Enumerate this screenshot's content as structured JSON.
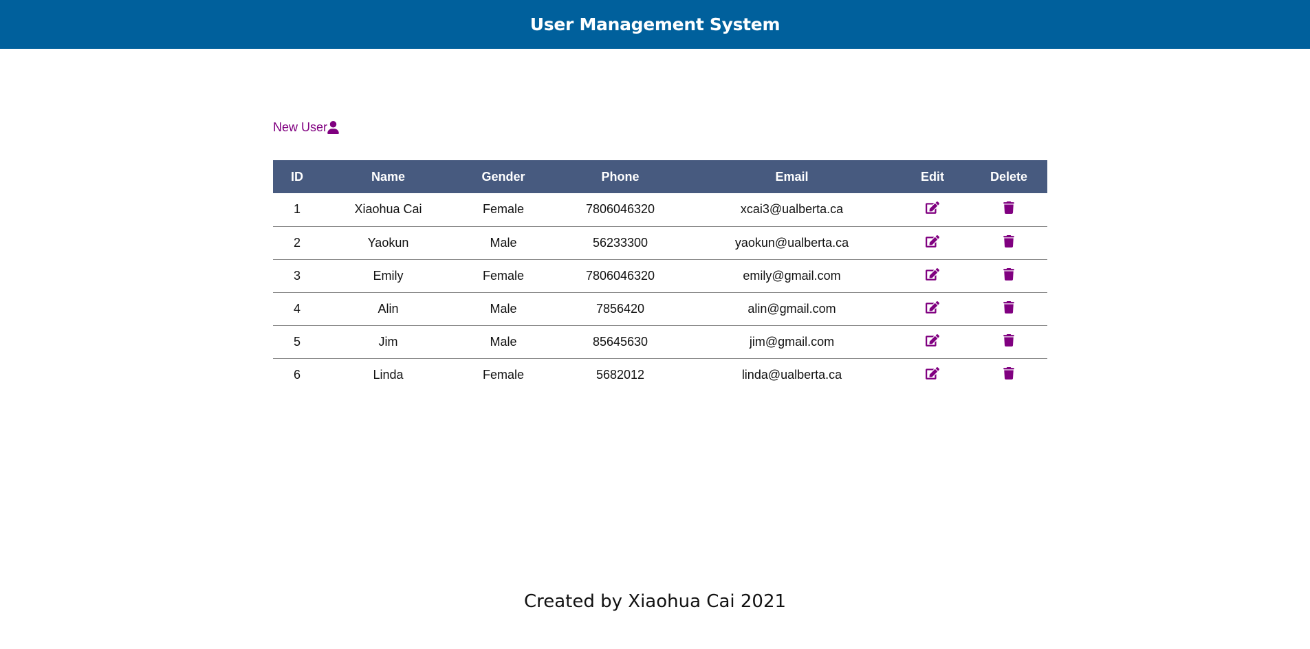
{
  "header": {
    "title": "User Management System"
  },
  "toolbar": {
    "new_user_label": "New User",
    "new_user_icon": "user-icon"
  },
  "table": {
    "columns": [
      "ID",
      "Name",
      "Gender",
      "Phone",
      "Email",
      "Edit",
      "Delete"
    ],
    "rows": [
      {
        "id": "1",
        "name": "Xiaohua Cai",
        "gender": "Female",
        "phone": "7806046320",
        "email": "xcai3@ualberta.ca"
      },
      {
        "id": "2",
        "name": "Yaokun",
        "gender": "Male",
        "phone": "56233300",
        "email": "yaokun@ualberta.ca"
      },
      {
        "id": "3",
        "name": "Emily",
        "gender": "Female",
        "phone": "7806046320",
        "email": "emily@gmail.com"
      },
      {
        "id": "4",
        "name": "Alin",
        "gender": "Male",
        "phone": "7856420",
        "email": "alin@gmail.com"
      },
      {
        "id": "5",
        "name": "Jim",
        "gender": "Male",
        "phone": "85645630",
        "email": "jim@gmail.com"
      },
      {
        "id": "6",
        "name": "Linda",
        "gender": "Female",
        "phone": "5682012",
        "email": "linda@ualberta.ca"
      }
    ],
    "edit_icon": "edit-icon",
    "delete_icon": "trash-icon"
  },
  "footer": {
    "text": "Created by Xiaohua Cai 2021"
  },
  "colors": {
    "header_bg": "#00609c",
    "table_header_bg": "#475a7f",
    "accent": "#800080"
  }
}
